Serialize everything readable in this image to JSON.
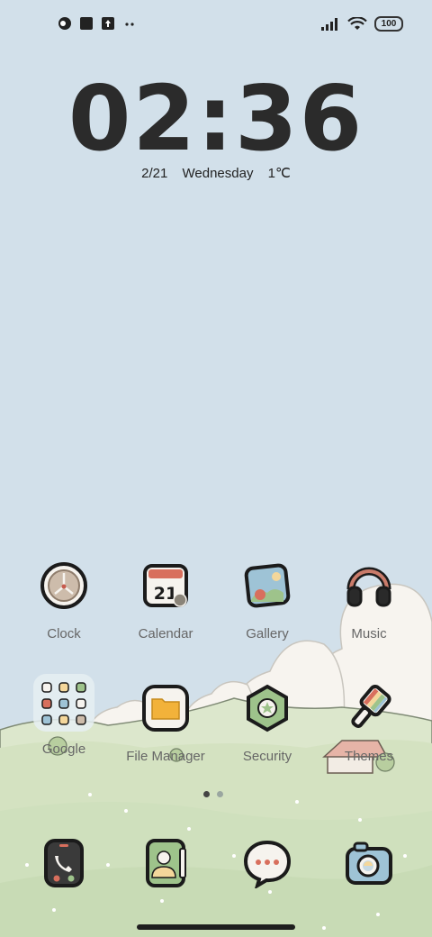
{
  "status_bar": {
    "left_icons": [
      "app-notification-icon",
      "square-notification-icon",
      "upload-notification-icon",
      "more-dots-icon"
    ],
    "right_icons": [
      "signal-icon",
      "wifi-icon"
    ],
    "battery": "100"
  },
  "lockscreen": {
    "time": "02:36",
    "date": "2/21",
    "weekday": "Wednesday",
    "temperature": "1℃"
  },
  "home": {
    "row1": [
      {
        "label": "Clock",
        "icon": "clock-icon"
      },
      {
        "label": "Calendar",
        "icon": "calendar-icon",
        "badge": "21"
      },
      {
        "label": "Gallery",
        "icon": "gallery-icon"
      },
      {
        "label": "Music",
        "icon": "headphones-icon"
      }
    ],
    "row2": [
      {
        "label": "Google",
        "icon": "folder-icon"
      },
      {
        "label": "File Manager",
        "icon": "file-manager-icon"
      },
      {
        "label": "Security",
        "icon": "security-icon"
      },
      {
        "label": "Themes",
        "icon": "paintbrush-icon"
      }
    ],
    "dock": [
      {
        "icon": "phone-icon"
      },
      {
        "icon": "contacts-icon"
      },
      {
        "icon": "messages-icon"
      },
      {
        "icon": "camera-icon"
      }
    ],
    "page_indicator": {
      "pages": 2,
      "current": 1
    }
  },
  "colors": {
    "sky": "#d2e0ea",
    "grass": "#d6e3c4",
    "cloud": "#f7f4ef",
    "icon_outline": "#1b1b1b"
  }
}
